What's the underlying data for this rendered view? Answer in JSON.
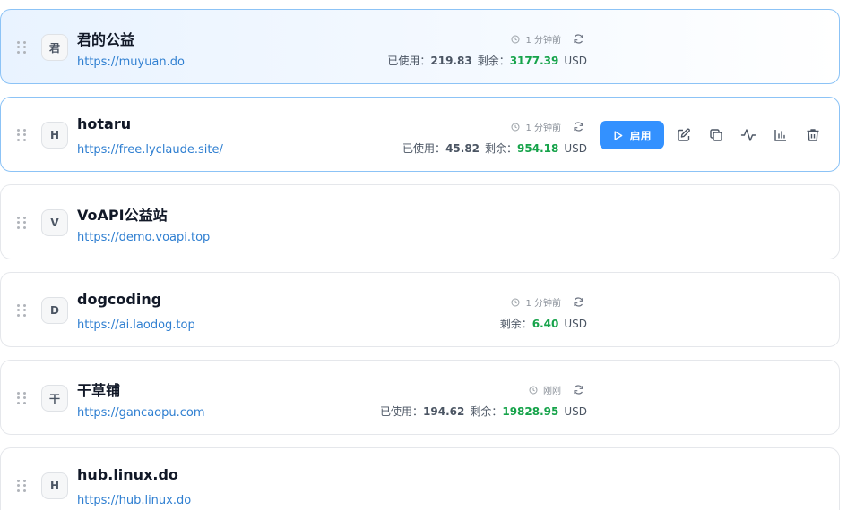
{
  "labels": {
    "used": "已使用：",
    "remaining": "剩余：",
    "currency": "USD",
    "enable": "启用"
  },
  "sites": [
    {
      "avatar": "君",
      "name": "君的公益",
      "url": "https://muyuan.do",
      "updated": "1 分钟前",
      "used": "219.83",
      "remaining": "3177.39"
    },
    {
      "avatar": "H",
      "name": "hotaru",
      "url": "https://free.lyclaude.site/",
      "updated": "1 分钟前",
      "used": "45.82",
      "remaining": "954.18"
    },
    {
      "avatar": "V",
      "name": "VoAPI公益站",
      "url": "https://demo.voapi.top"
    },
    {
      "avatar": "D",
      "name": "dogcoding",
      "url": "https://ai.laodog.top",
      "updated": "1 分钟前",
      "remaining": "6.40"
    },
    {
      "avatar": "干",
      "name": "干草铺",
      "url": "https://gancaopu.com",
      "updated": "刚刚",
      "used": "194.62",
      "remaining": "19828.95"
    },
    {
      "avatar": "H",
      "name": "hub.linux.do",
      "url": "https://hub.linux.do"
    }
  ],
  "icons": {
    "drag": "drag-handle-icon",
    "clock": "clock-icon",
    "refresh": "refresh-icon",
    "play": "play-icon",
    "edit": "edit-icon",
    "copy": "copy-icon",
    "activity": "activity-icon",
    "chart": "bar-chart-icon",
    "delete": "trash-icon"
  },
  "colors": {
    "accent": "#3391ff",
    "remaining": "#16a34a",
    "link": "#2f7fd1",
    "selected_border": "#8cc3f6"
  }
}
